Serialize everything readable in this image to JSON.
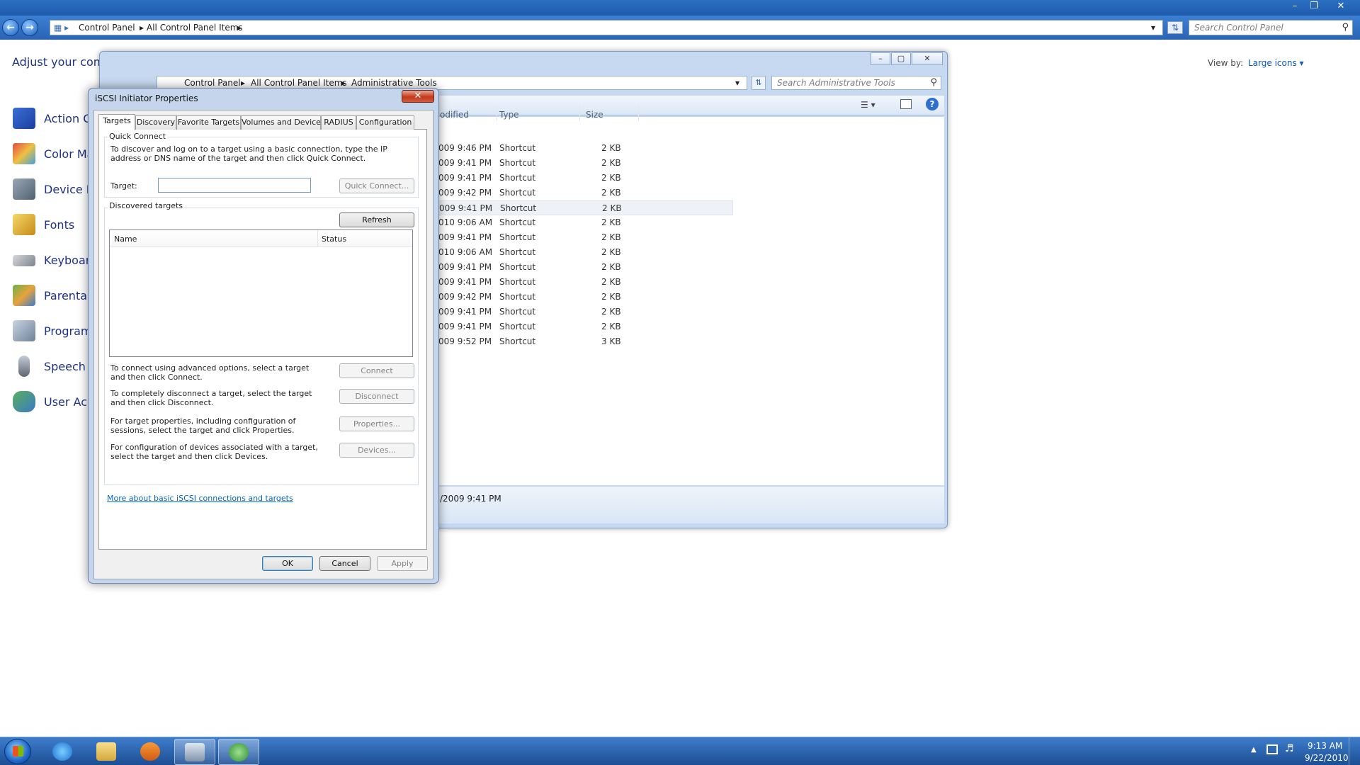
{
  "control_panel": {
    "breadcrumbs": [
      "Control Panel",
      "All Control Panel Items"
    ],
    "search_placeholder": "Search Control Panel",
    "heading": "Adjust your comp",
    "view_by_label": "View by:",
    "view_by_value": "Large icons",
    "items": [
      {
        "label": "Action Ce",
        "icon": "flag-icon"
      },
      {
        "label": "Color Ma",
        "icon": "color-icon"
      },
      {
        "label": "Device M",
        "icon": "device-icon"
      },
      {
        "label": "Fonts",
        "icon": "fonts-icon"
      },
      {
        "label": "Keyboard",
        "icon": "keyboard-icon"
      },
      {
        "label": "Parental",
        "icon": "parental-icon"
      },
      {
        "label": "Programs",
        "icon": "programs-icon"
      },
      {
        "label": "Speech R",
        "icon": "microphone-icon"
      },
      {
        "label": "User Acc",
        "icon": "users-icon"
      }
    ]
  },
  "admin_tools": {
    "breadcrumbs": [
      "Control Panel",
      "All Control Panel Items",
      "Administrative Tools"
    ],
    "search_placeholder": "Search Administrative Tools",
    "columns": {
      "modified": "odified",
      "type": "Type",
      "size": "Size"
    },
    "rows": [
      {
        "modified": "009 9:46 PM",
        "type": "Shortcut",
        "size": "2 KB"
      },
      {
        "modified": "009 9:41 PM",
        "type": "Shortcut",
        "size": "2 KB"
      },
      {
        "modified": "009 9:41 PM",
        "type": "Shortcut",
        "size": "2 KB"
      },
      {
        "modified": "009 9:42 PM",
        "type": "Shortcut",
        "size": "2 KB"
      },
      {
        "modified": "009 9:41 PM",
        "type": "Shortcut",
        "size": "2 KB"
      },
      {
        "modified": "010 9:06 AM",
        "type": "Shortcut",
        "size": "2 KB"
      },
      {
        "modified": "009 9:41 PM",
        "type": "Shortcut",
        "size": "2 KB"
      },
      {
        "modified": "010 9:06 AM",
        "type": "Shortcut",
        "size": "2 KB"
      },
      {
        "modified": "009 9:41 PM",
        "type": "Shortcut",
        "size": "2 KB"
      },
      {
        "modified": "009 9:41 PM",
        "type": "Shortcut",
        "size": "2 KB"
      },
      {
        "modified": "009 9:42 PM",
        "type": "Shortcut",
        "size": "2 KB"
      },
      {
        "modified": "009 9:41 PM",
        "type": "Shortcut",
        "size": "2 KB"
      },
      {
        "modified": "009 9:41 PM",
        "type": "Shortcut",
        "size": "2 KB"
      },
      {
        "modified": "009 9:52 PM",
        "type": "Shortcut",
        "size": "3 KB"
      }
    ],
    "details_modified": "/2009 9:41 PM"
  },
  "dialog": {
    "title": "iSCSI Initiator Properties",
    "close_glyph": "✕",
    "tabs": [
      "Targets",
      "Discovery",
      "Favorite Targets",
      "Volumes and Devices",
      "RADIUS",
      "Configuration"
    ],
    "quick_connect": {
      "group_label": "Quick Connect",
      "description": "To discover and log on to a target using a basic connection, type the IP address or DNS name of the target and then click Quick Connect.",
      "target_label": "Target:",
      "target_value": "",
      "button": "Quick Connect..."
    },
    "discovered": {
      "group_label": "Discovered targets",
      "refresh_button": "Refresh",
      "columns": [
        "Name",
        "Status"
      ],
      "actions": [
        {
          "text": "To connect using advanced options, select a target and then click Connect.",
          "button": "Connect"
        },
        {
          "text": "To completely disconnect a target, select the target and then click Disconnect.",
          "button": "Disconnect"
        },
        {
          "text": "For target properties, including configuration of sessions, select the target and click Properties.",
          "button": "Properties..."
        },
        {
          "text": "For configuration of devices associated with a target, select the target and then click Devices.",
          "button": "Devices..."
        }
      ]
    },
    "link": "More about basic iSCSI connections and targets",
    "buttons": {
      "ok": "OK",
      "cancel": "Cancel",
      "apply": "Apply"
    }
  },
  "taskbar": {
    "time": "9:13 AM",
    "date": "9/22/2010"
  }
}
